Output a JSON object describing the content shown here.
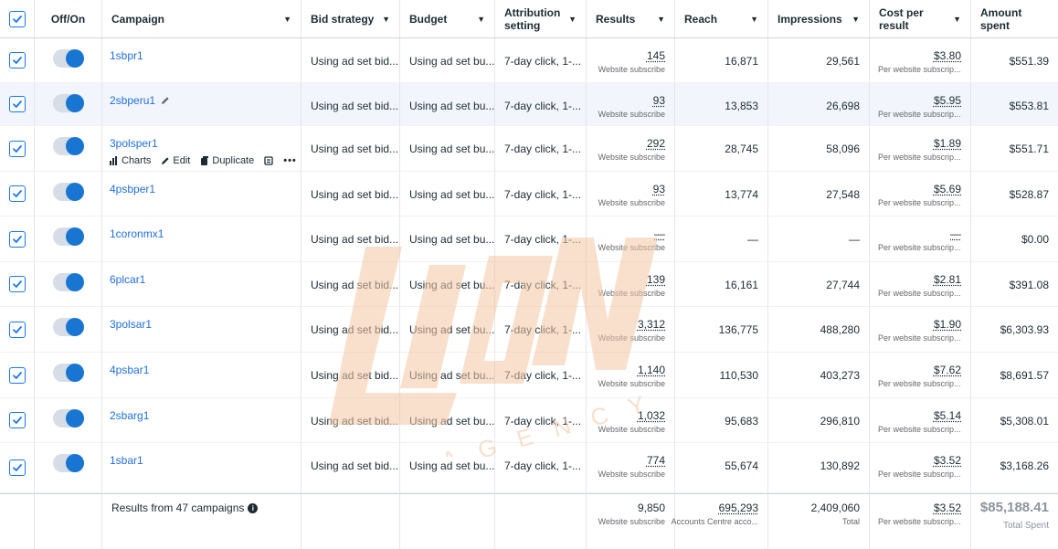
{
  "header": {
    "off_on": "Off/On",
    "campaign": "Campaign",
    "bid_strategy": "Bid strategy",
    "budget": "Budget",
    "attribution_1": "Attribution",
    "attribution_2": "setting",
    "results": "Results",
    "reach": "Reach",
    "impressions": "Impressions",
    "cost_per_result": "Cost per result",
    "amount_spent": "Amount spent"
  },
  "row_actions": {
    "charts": "Charts",
    "edit": "Edit",
    "duplicate": "Duplicate"
  },
  "rows": [
    {
      "name": "1sbpr1",
      "bid": "Using ad set bid...",
      "budget": "Using ad set bu...",
      "attribution": "7-day click, 1-...",
      "results": "145",
      "results_sub": "Website subscribe",
      "reach": "16,871",
      "impressions": "29,561",
      "cpr": "$3.80",
      "cpr_sub": "Per website subscrip...",
      "spent": "$551.39"
    },
    {
      "name": "2sbperu1",
      "bid": "Using ad set bid...",
      "budget": "Using ad set bu...",
      "attribution": "7-day click, 1-...",
      "results": "93",
      "results_sub": "Website subscribe",
      "reach": "13,853",
      "impressions": "26,698",
      "cpr": "$5.95",
      "cpr_sub": "Per website subscrip...",
      "spent": "$553.81"
    },
    {
      "name": "3polsper1",
      "bid": "Using ad set bid...",
      "budget": "Using ad set bu...",
      "attribution": "7-day click, 1-...",
      "results": "292",
      "results_sub": "Website subscribe",
      "reach": "28,745",
      "impressions": "58,096",
      "cpr": "$1.89",
      "cpr_sub": "Per website subscrip...",
      "spent": "$551.71"
    },
    {
      "name": "4psbper1",
      "bid": "Using ad set bid...",
      "budget": "Using ad set bu...",
      "attribution": "7-day click, 1-...",
      "results": "93",
      "results_sub": "Website subscribe",
      "reach": "13,774",
      "impressions": "27,548",
      "cpr": "$5.69",
      "cpr_sub": "Per website subscrip...",
      "spent": "$528.87"
    },
    {
      "name": "1coronmx1",
      "bid": "Using ad set bid...",
      "budget": "Using ad set bu...",
      "attribution": "7-day click, 1-...",
      "results": "—",
      "results_sub": "Website subscribe",
      "reach": "—",
      "impressions": "—",
      "cpr": "—",
      "cpr_sub": "Per website subscrip...",
      "spent": "$0.00"
    },
    {
      "name": "6plcar1",
      "bid": "Using ad set bid...",
      "budget": "Using ad set bu...",
      "attribution": "7-day click, 1-...",
      "results": "139",
      "results_sub": "Website subscribe",
      "reach": "16,161",
      "impressions": "27,744",
      "cpr": "$2.81",
      "cpr_sub": "Per website subscrip...",
      "spent": "$391.08"
    },
    {
      "name": "3polsar1",
      "bid": "Using ad set bid...",
      "budget": "Using ad set bu...",
      "attribution": "7-day click, 1-...",
      "results": "3,312",
      "results_sub": "Website subscribe",
      "reach": "136,775",
      "impressions": "488,280",
      "cpr": "$1.90",
      "cpr_sub": "Per website subscrip...",
      "spent": "$6,303.93"
    },
    {
      "name": "4psbar1",
      "bid": "Using ad set bid...",
      "budget": "Using ad set bu...",
      "attribution": "7-day click, 1-...",
      "results": "1,140",
      "results_sub": "Website subscribe",
      "reach": "110,530",
      "impressions": "403,273",
      "cpr": "$7.62",
      "cpr_sub": "Per website subscrip...",
      "spent": "$8,691.57"
    },
    {
      "name": "2sbarg1",
      "bid": "Using ad set bid...",
      "budget": "Using ad set bu...",
      "attribution": "7-day click, 1-...",
      "results": "1,032",
      "results_sub": "Website subscribe",
      "reach": "95,683",
      "impressions": "296,810",
      "cpr": "$5.14",
      "cpr_sub": "Per website subscrip...",
      "spent": "$5,308.01"
    },
    {
      "name": "1sbar1",
      "bid": "Using ad set bid...",
      "budget": "Using ad set bu...",
      "attribution": "7-day click, 1-...",
      "results": "774",
      "results_sub": "Website subscribe",
      "reach": "55,674",
      "impressions": "130,892",
      "cpr": "$3.52",
      "cpr_sub": "Per website subscrip...",
      "spent": "$3,168.26"
    }
  ],
  "footer": {
    "label": "Results from 47 campaigns",
    "results": "9,850",
    "results_sub": "Website subscribe",
    "reach": "695,293",
    "reach_sub": "Accounts Centre acco...",
    "impressions": "2,409,060",
    "impressions_sub": "Total",
    "cpr": "$3.52",
    "cpr_sub": "Per website subscrip...",
    "spent": "$85,188.41",
    "spent_sub": "Total Spent"
  },
  "watermark": {
    "logo_text": "LION",
    "sub_text": "AGENCY"
  },
  "colors": {
    "accent": "#1877f2",
    "link": "#216fdb",
    "toggle_on": "#1876d2",
    "watermark": "#f4c7a6"
  }
}
